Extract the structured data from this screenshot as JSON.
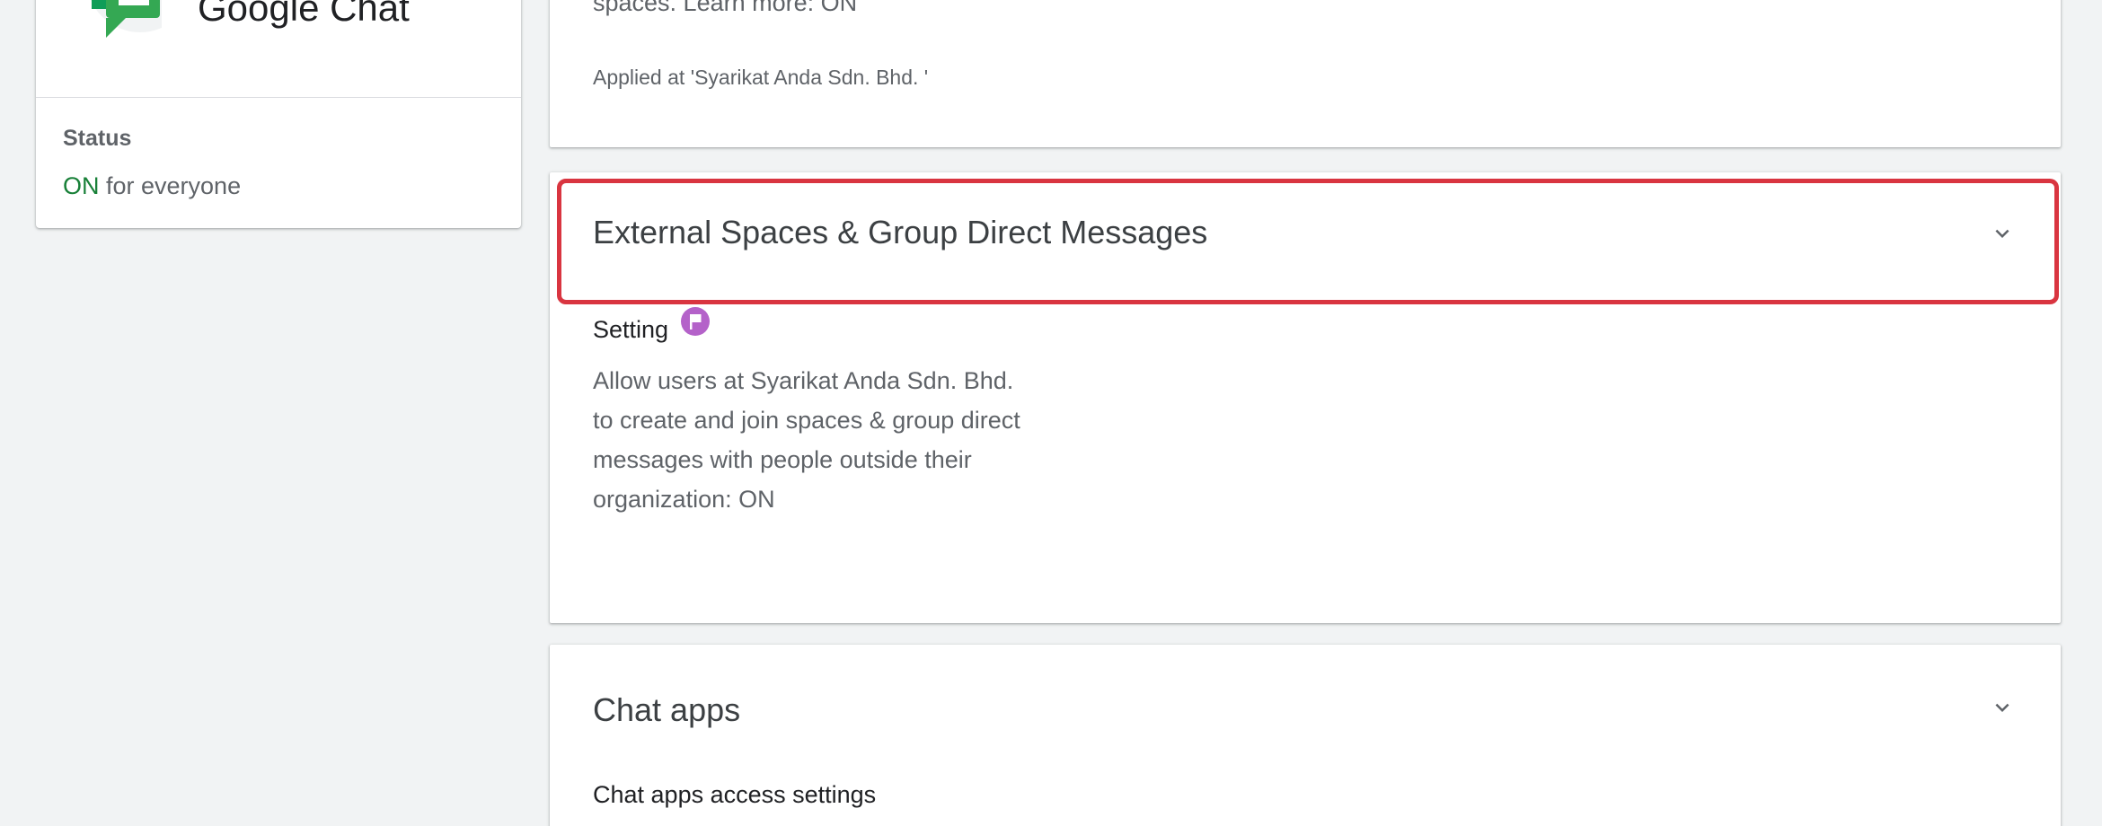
{
  "app": {
    "name": "Google Chat",
    "status_label": "Status",
    "status_on": "ON",
    "status_suffix": " for everyone",
    "icon": "google-chat-logo"
  },
  "top_card": {
    "partial_text": "spaces. Learn more: ON",
    "applied_text": "Applied at 'Syarikat Anda Sdn. Bhd. '"
  },
  "external_card": {
    "title": "External Spaces & Group Direct Messages",
    "setting_label": "Setting",
    "description_lines": [
      "Allow users at Syarikat Anda Sdn. Bhd.",
      "to create and join spaces & group direct",
      "messages with people outside their",
      "organization: ON"
    ],
    "highlight_color": "#d93540",
    "badge_color": "#b462c9",
    "badge_icon": "flag-icon",
    "expand_icon": "chevron-down-icon"
  },
  "chatapps_card": {
    "title": "Chat apps",
    "subtitle": "Chat apps access settings",
    "expand_icon": "chevron-down-icon"
  },
  "colors": {
    "on_green": "#188038",
    "background": "#f1f3f4"
  }
}
